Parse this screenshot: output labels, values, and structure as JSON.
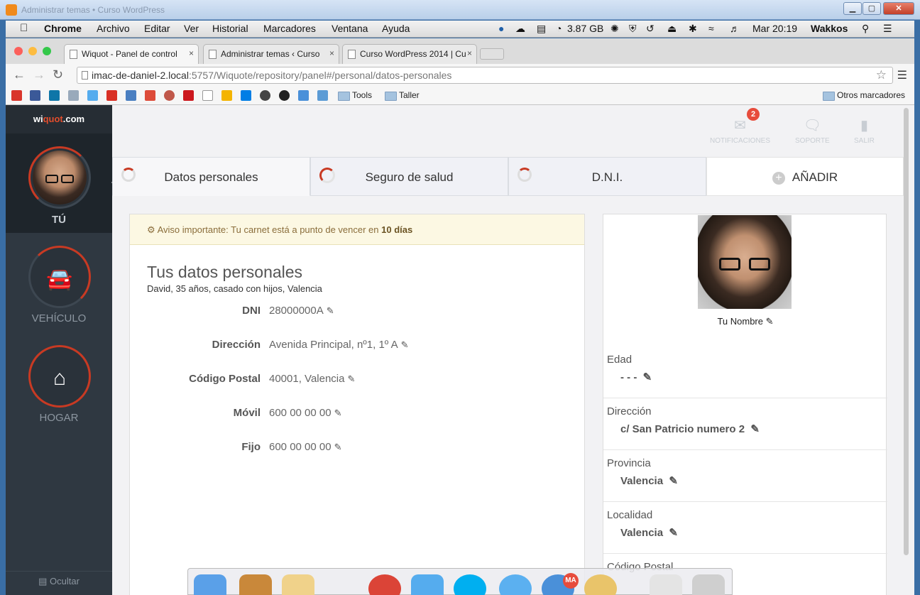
{
  "window": {
    "blurred_title": "Administrar temas • Curso WordPress",
    "controls": {
      "min": "▁",
      "max": "▢",
      "close": "✕"
    }
  },
  "menubar": {
    "app": "Chrome",
    "items": [
      "Archivo",
      "Editar",
      "Ver",
      "Historial",
      "Marcadores",
      "Ventana",
      "Ayuda"
    ],
    "disk": "3.87 GB",
    "clock": "Mar 20:19",
    "user": "Wakkos"
  },
  "tabs": [
    {
      "label": "Wiquot - Panel de control",
      "close": "×"
    },
    {
      "label": "Administrar temas ‹ Curso",
      "close": "×"
    },
    {
      "label": "Curso WordPress 2014 | Cu",
      "close": "×"
    }
  ],
  "address": {
    "host": "imac-de-daniel-2.local",
    "rest": ":5757/Wiquote/repository/panel#/personal/datos-personales"
  },
  "bookmarks": {
    "folders": [
      "Tools",
      "Taller"
    ],
    "other": "Otros marcadores"
  },
  "sidebar": {
    "logo_pre": "wi",
    "logo_mid": "quot",
    "logo_post": ".com",
    "items": [
      {
        "label": "TÚ"
      },
      {
        "label": "VEHÍCULO"
      },
      {
        "label": "HOGAR"
      }
    ],
    "hide": "Ocultar"
  },
  "topbar": {
    "notificaciones": "Notificaciones",
    "notif_count": "2",
    "soporte": "Soporte",
    "salir": "Salir"
  },
  "page_tabs": [
    {
      "label": "Datos personales"
    },
    {
      "label": "Seguro de salud"
    },
    {
      "label": "D.N.I."
    },
    {
      "label": "AÑADIR"
    }
  ],
  "notice": {
    "text": "Aviso importante: Tu carnet está a punto de vencer en",
    "strong": "10 días"
  },
  "personal": {
    "title": "Tus datos personales",
    "subtitle": "David, 35 años, casado con hijos, Valencia",
    "fields": [
      {
        "label": "DNI",
        "value": "28000000A"
      },
      {
        "label": "Dirección",
        "value": "Avenida Principal, nº1, 1º A"
      },
      {
        "label": "Código Postal",
        "value": "40001, Valencia"
      },
      {
        "label": "Móvil",
        "value": "600 00 00 00"
      },
      {
        "label": "Fijo",
        "value": "600 00 00 00"
      }
    ]
  },
  "profile": {
    "name": "Tu Nombre",
    "rows": [
      {
        "label": "Edad",
        "value": "- - -"
      },
      {
        "label": "Dirección",
        "value": "c/ San Patricio numero 2"
      },
      {
        "label": "Provincia",
        "value": "Valencia"
      },
      {
        "label": "Localidad",
        "value": "Valencia"
      },
      {
        "label": "Código Postal",
        "value": ""
      }
    ]
  },
  "dock": {
    "badge": "MA"
  }
}
